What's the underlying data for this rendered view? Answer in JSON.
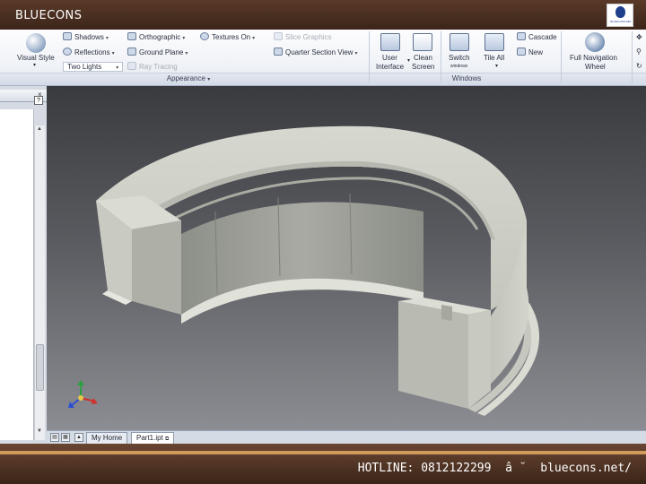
{
  "brand": {
    "name": "BLUECONS",
    "logo_text": "BLUECONS.NET"
  },
  "ribbon": {
    "visual_style": "Visual Style",
    "shadows": "Shadows",
    "reflections": "Reflections",
    "two_lights": "Two Lights",
    "orthographic": "Orthographic",
    "ground_plane": "Ground Plane",
    "ray_tracing": "Ray Tracing",
    "textures_on": "Textures On",
    "slice_graphics": "Slice Graphics",
    "quarter_section_view": "Quarter Section View",
    "appearance_group": "Appearance",
    "user_interface_1": "User",
    "user_interface_2": "Interface",
    "clean_screen_1": "Clean",
    "clean_screen_2": "Screen",
    "switch": "Switch",
    "switch_sub": "windows",
    "tile_all": "Tile All",
    "cascade": "Cascade",
    "new": "New",
    "windows_group": "Windows",
    "full_nav_1": "Full Navigation",
    "full_nav_2": "Wheel"
  },
  "left_panel": {
    "close": "×",
    "help": "?"
  },
  "doc_tabs": {
    "home": "My Home",
    "part": "Part1.ipt"
  },
  "footer": {
    "hotline": "HOTLINE: 0812122299  â ˘  bluecons.net/"
  },
  "colors": {
    "brand_bar": "#4a2e20",
    "accent_stripe": "#d09a5a",
    "ribbon_bg": "#eef1f6",
    "viewport_top": "#3a3b3f",
    "viewport_bottom": "#8c8d92",
    "model_face": "#c9cbc2"
  }
}
